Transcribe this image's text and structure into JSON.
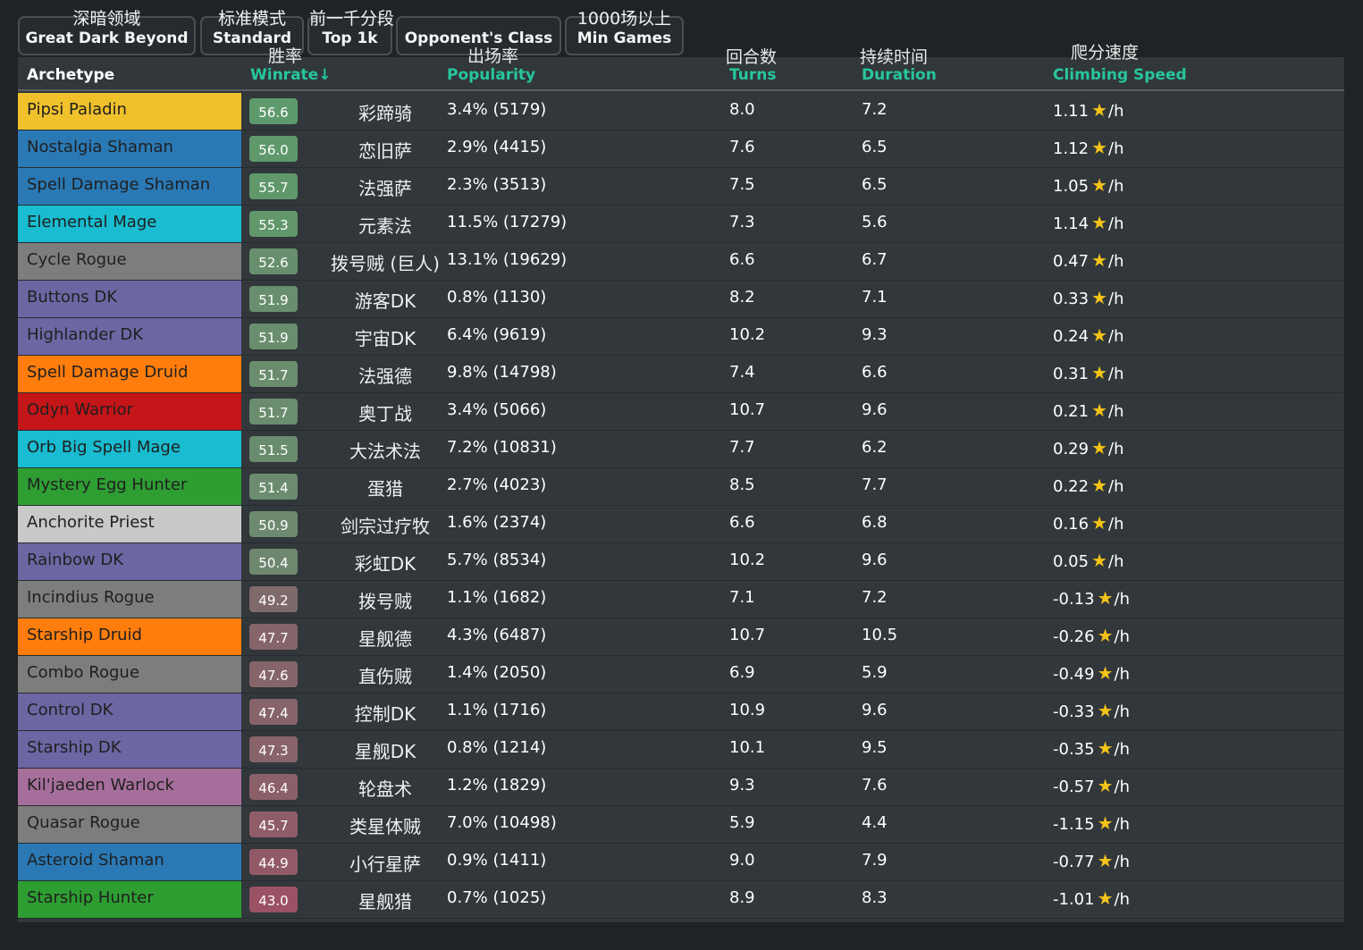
{
  "filters": [
    {
      "zh": "深暗领域",
      "en": "Great Dark Beyond"
    },
    {
      "zh": "标准模式",
      "en": "Standard"
    },
    {
      "zh": "前一千分段",
      "en": "Top 1k"
    },
    {
      "zh": "",
      "en": "Opponent's Class"
    },
    {
      "zh": "1000场以上",
      "en": "Min Games"
    }
  ],
  "columns": {
    "archetype": {
      "en": "Archetype"
    },
    "winrate": {
      "zh": "胜率",
      "en": "Winrate↓"
    },
    "popularity": {
      "zh": "出场率",
      "en": "Popularity"
    },
    "turns": {
      "zh": "回合数",
      "en": "Turns"
    },
    "duration": {
      "zh": "持续时间",
      "en": "Duration"
    },
    "climbing": {
      "zh": "爬分速度",
      "en": "Climbing Speed"
    }
  },
  "star_icon": "star-icon",
  "colors": {
    "background": "#1f2326",
    "table": "#31373b",
    "header_accent": "#27c79a",
    "star": "#f5c418"
  },
  "rows": [
    {
      "name": "Pipsi Paladin",
      "winrate": "56.6",
      "zh": "彩蹄骑",
      "popularity": "3.4% (5179)",
      "turns": "8.0",
      "duration": "7.2",
      "climb": "1.11",
      "unit": "/h",
      "color": "#f0c12b",
      "text": "#1f1f1f",
      "badge": "#5e9a6c"
    },
    {
      "name": "Nostalgia Shaman",
      "winrate": "56.0",
      "zh": "恋旧萨",
      "popularity": "2.9% (4415)",
      "turns": "7.6",
      "duration": "6.5",
      "climb": "1.12",
      "unit": "/h",
      "color": "#2a79b5",
      "text": "#1f1f1f",
      "badge": "#5f996b"
    },
    {
      "name": "Spell Damage Shaman",
      "winrate": "55.7",
      "zh": "法强萨",
      "popularity": "2.3% (3513)",
      "turns": "7.5",
      "duration": "6.5",
      "climb": "1.05",
      "unit": "/h",
      "color": "#2a79b5",
      "text": "#1f1f1f",
      "badge": "#60986b"
    },
    {
      "name": "Elemental Mage",
      "winrate": "55.3",
      "zh": "元素法",
      "popularity": "11.5% (17279)",
      "turns": "7.3",
      "duration": "5.6",
      "climb": "1.14",
      "unit": "/h",
      "color": "#19bcd0",
      "text": "#1f1f1f",
      "badge": "#61976b"
    },
    {
      "name": "Cycle Rogue",
      "winrate": "52.6",
      "zh": "拨号贼 (巨人)",
      "popularity": "13.1% (19629)",
      "turns": "6.6",
      "duration": "6.7",
      "climb": "0.47",
      "unit": "/h",
      "color": "#7d7d7d",
      "text": "#1f1f1f",
      "badge": "#688f6d"
    },
    {
      "name": "Buttons DK",
      "winrate": "51.9",
      "zh": "游客DK",
      "popularity": "0.8% (1130)",
      "turns": "8.2",
      "duration": "7.1",
      "climb": "0.33",
      "unit": "/h",
      "color": "#6c66a3",
      "text": "#1f1f1f",
      "badge": "#698e6e"
    },
    {
      "name": "Highlander DK",
      "winrate": "51.9",
      "zh": "宇宙DK",
      "popularity": "6.4% (9619)",
      "turns": "10.2",
      "duration": "9.3",
      "climb": "0.24",
      "unit": "/h",
      "color": "#6c66a3",
      "text": "#1f1f1f",
      "badge": "#698e6e"
    },
    {
      "name": "Spell Damage Druid",
      "winrate": "51.7",
      "zh": "法强德",
      "popularity": "9.8% (14798)",
      "turns": "7.4",
      "duration": "6.6",
      "climb": "0.31",
      "unit": "/h",
      "color": "#ff7d0c",
      "text": "#1f1f1f",
      "badge": "#6a8d6e"
    },
    {
      "name": "Odyn Warrior",
      "winrate": "51.7",
      "zh": "奥丁战",
      "popularity": "3.4% (5066)",
      "turns": "10.7",
      "duration": "9.6",
      "climb": "0.21",
      "unit": "/h",
      "color": "#c41519",
      "text": "#1f1f1f",
      "badge": "#6a8d6e"
    },
    {
      "name": "Orb Big Spell Mage",
      "winrate": "51.5",
      "zh": "大法术法",
      "popularity": "7.2% (10831)",
      "turns": "7.7",
      "duration": "6.2",
      "climb": "0.29",
      "unit": "/h",
      "color": "#19bcd0",
      "text": "#1f1f1f",
      "badge": "#6a8c6e"
    },
    {
      "name": "Mystery Egg Hunter",
      "winrate": "51.4",
      "zh": "蛋猎",
      "popularity": "2.7% (4023)",
      "turns": "8.5",
      "duration": "7.7",
      "climb": "0.22",
      "unit": "/h",
      "color": "#2e9e33",
      "text": "#1f1f1f",
      "badge": "#6b8c6e"
    },
    {
      "name": "Anchorite Priest",
      "winrate": "50.9",
      "zh": "剑宗过疗牧",
      "popularity": "1.6% (2374)",
      "turns": "6.6",
      "duration": "6.8",
      "climb": "0.16",
      "unit": "/h",
      "color": "#c9c9c9",
      "text": "#1f1f1f",
      "badge": "#6d896f"
    },
    {
      "name": "Rainbow DK",
      "winrate": "50.4",
      "zh": "彩虹DK",
      "popularity": "5.7% (8534)",
      "turns": "10.2",
      "duration": "9.6",
      "climb": "0.05",
      "unit": "/h",
      "color": "#6c66a3",
      "text": "#1f1f1f",
      "badge": "#6e876f"
    },
    {
      "name": "Incindius Rogue",
      "winrate": "49.2",
      "zh": "拨号贼",
      "popularity": "1.1% (1682)",
      "turns": "7.1",
      "duration": "7.2",
      "climb": "-0.13",
      "unit": "/h",
      "color": "#7d7d7d",
      "text": "#1f1f1f",
      "badge": "#7f6a6b"
    },
    {
      "name": "Starship Druid",
      "winrate": "47.7",
      "zh": "星舰德",
      "popularity": "4.3% (6487)",
      "turns": "10.7",
      "duration": "10.5",
      "climb": "-0.26",
      "unit": "/h",
      "color": "#ff7d0c",
      "text": "#1f1f1f",
      "badge": "#86656a"
    },
    {
      "name": "Combo Rogue",
      "winrate": "47.6",
      "zh": "直伤贼",
      "popularity": "1.4% (2050)",
      "turns": "6.9",
      "duration": "5.9",
      "climb": "-0.49",
      "unit": "/h",
      "color": "#7d7d7d",
      "text": "#1f1f1f",
      "badge": "#86656a"
    },
    {
      "name": "Control DK",
      "winrate": "47.4",
      "zh": "控制DK",
      "popularity": "1.1% (1716)",
      "turns": "10.9",
      "duration": "9.6",
      "climb": "-0.33",
      "unit": "/h",
      "color": "#6c66a3",
      "text": "#1f1f1f",
      "badge": "#87646a"
    },
    {
      "name": "Starship DK",
      "winrate": "47.3",
      "zh": "星舰DK",
      "popularity": "0.8% (1214)",
      "turns": "10.1",
      "duration": "9.5",
      "climb": "-0.35",
      "unit": "/h",
      "color": "#6c66a3",
      "text": "#1f1f1f",
      "badge": "#88646a"
    },
    {
      "name": "Kil'jaeden Warlock",
      "winrate": "46.4",
      "zh": "轮盘术",
      "popularity": "1.2% (1829)",
      "turns": "9.3",
      "duration": "7.6",
      "climb": "-0.57",
      "unit": "/h",
      "color": "#a66f9b",
      "text": "#1f1f1f",
      "badge": "#8b6069"
    },
    {
      "name": "Quasar Rogue",
      "winrate": "45.7",
      "zh": "类星体贼",
      "popularity": "7.0% (10498)",
      "turns": "5.9",
      "duration": "4.4",
      "climb": "-1.15",
      "unit": "/h",
      "color": "#7d7d7d",
      "text": "#1f1f1f",
      "badge": "#8e5d68"
    },
    {
      "name": "Asteroid Shaman",
      "winrate": "44.9",
      "zh": "小行星萨",
      "popularity": "0.9% (1411)",
      "turns": "9.0",
      "duration": "7.9",
      "climb": "-0.77",
      "unit": "/h",
      "color": "#2a79b5",
      "text": "#1f1f1f",
      "badge": "#925a67"
    },
    {
      "name": "Starship Hunter",
      "winrate": "43.0",
      "zh": "星舰猎",
      "popularity": "0.7% (1025)",
      "turns": "8.9",
      "duration": "8.3",
      "climb": "-1.01",
      "unit": "/h",
      "color": "#2e9e33",
      "text": "#1f1f1f",
      "badge": "#9a5264"
    }
  ]
}
